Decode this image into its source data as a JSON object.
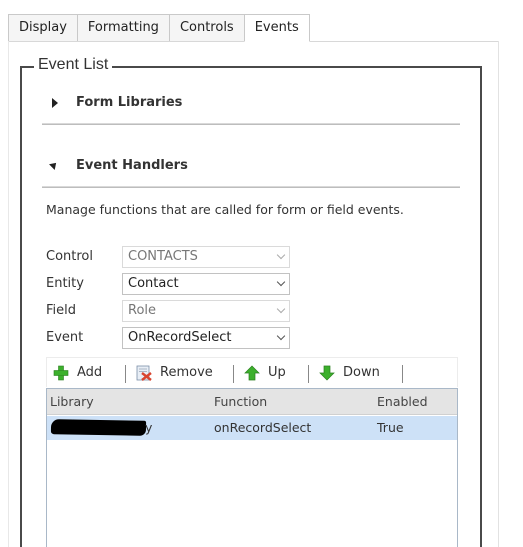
{
  "tabs": [
    {
      "label": "Display",
      "active": false
    },
    {
      "label": "Formatting",
      "active": false
    },
    {
      "label": "Controls",
      "active": false
    },
    {
      "label": "Events",
      "active": true
    }
  ],
  "event_list": {
    "legend": "Event List",
    "form_libraries": {
      "label": "Form Libraries",
      "expanded": false
    },
    "event_handlers": {
      "label": "Event Handlers",
      "expanded": true
    },
    "description": "Manage functions that are called for form or field events."
  },
  "fields": {
    "control": {
      "label": "Control",
      "value": "CONTACTS",
      "disabled": true
    },
    "entity": {
      "label": "Entity",
      "value": "Contact",
      "disabled": false
    },
    "field": {
      "label": "Field",
      "value": "Role",
      "disabled": true
    },
    "event": {
      "label": "Event",
      "value": "OnRecordSelect",
      "disabled": false
    }
  },
  "toolbar": {
    "add": "Add",
    "remove": "Remove",
    "up": "Up",
    "down": "Down"
  },
  "grid": {
    "columns": [
      "Library",
      "Function",
      "Enabled"
    ],
    "rows": [
      {
        "library": "",
        "library_suffix": "y",
        "function": "onRecordSelect",
        "enabled": "True",
        "selected": true
      }
    ]
  },
  "colors": {
    "selected_row": "#cde1f7",
    "add_icon": "#3cb02c",
    "arrow_icon": "#3cb02c",
    "remove_icon": "#d9442f"
  },
  "icons": [
    "chevron-right-icon",
    "chevron-down-icon",
    "add-icon",
    "remove-icon",
    "up-arrow-icon",
    "down-arrow-icon",
    "dropdown-chevron-icon"
  ]
}
